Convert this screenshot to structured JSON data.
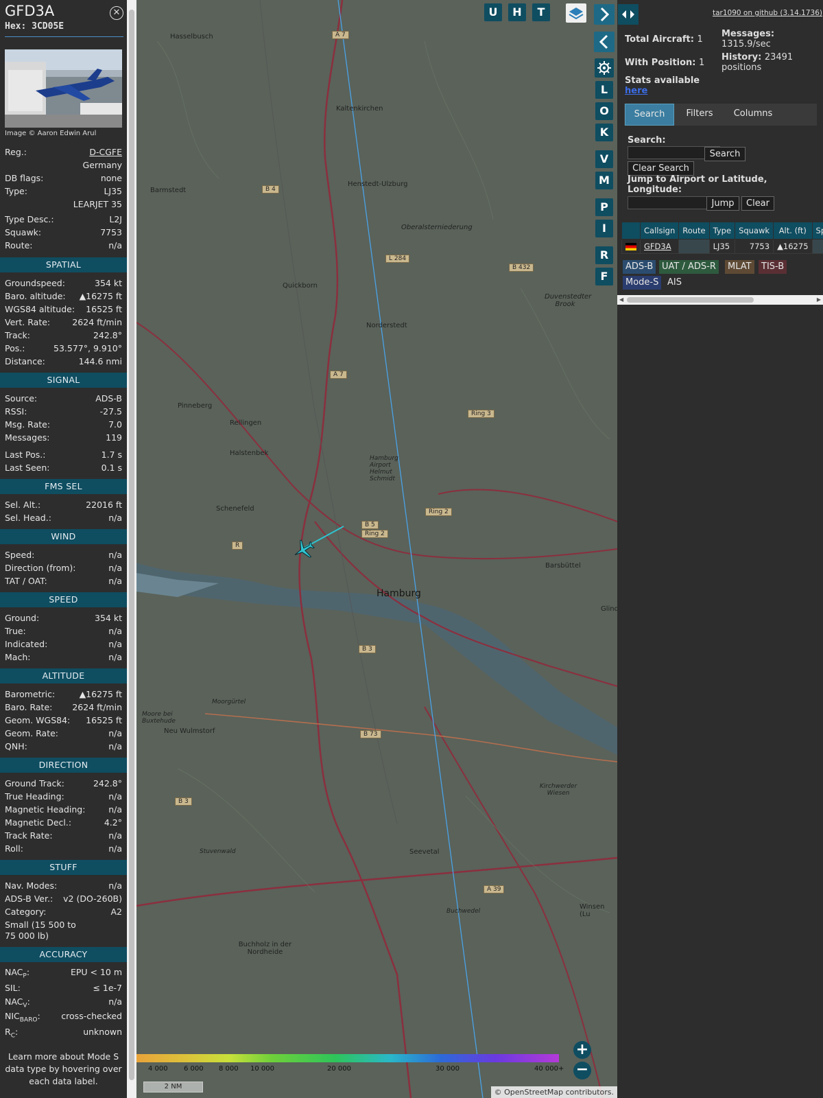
{
  "aircraft": {
    "callsign": "GFD3A",
    "hex_label": "Hex:",
    "hex": "3CD05E",
    "image_credit": "Image © Aaron Edwin Arul",
    "basic": [
      {
        "k": "Reg.:",
        "v": "D-CGFE"
      },
      {
        "k": "",
        "v": "Germany"
      },
      {
        "k": "DB flags:",
        "v": "none"
      },
      {
        "k": "Type:",
        "v": "LJ35"
      },
      {
        "k": "",
        "v": "LEARJET 35"
      },
      {
        "k": "Type Desc.:",
        "v": "L2J"
      },
      {
        "k": "Squawk:",
        "v": "7753"
      },
      {
        "k": "Route:",
        "v": "n/a"
      }
    ]
  },
  "sections": {
    "spatial": {
      "title": "SPATIAL",
      "rows": [
        {
          "k": "Groundspeed:",
          "v": "354 kt"
        },
        {
          "k": "Baro. altitude:",
          "v": "▲16275 ft"
        },
        {
          "k": "WGS84 altitude:",
          "v": "16525 ft"
        },
        {
          "k": "Vert. Rate:",
          "v": "2624 ft/min"
        },
        {
          "k": "Track:",
          "v": "242.8°"
        },
        {
          "k": "Pos.:",
          "v": "53.577°, 9.910°"
        },
        {
          "k": "Distance:",
          "v": "144.6 nmi"
        }
      ]
    },
    "signal": {
      "title": "SIGNAL",
      "rows": [
        {
          "k": "Source:",
          "v": "ADS-B"
        },
        {
          "k": "RSSI:",
          "v": "-27.5"
        },
        {
          "k": "Msg. Rate:",
          "v": "7.0"
        },
        {
          "k": "Messages:",
          "v": "119"
        },
        {
          "k": "Last Pos.:",
          "v": "1.7 s"
        },
        {
          "k": "Last Seen:",
          "v": "0.1 s"
        }
      ]
    },
    "fms": {
      "title": "FMS SEL",
      "rows": [
        {
          "k": "Sel. Alt.:",
          "v": "22016 ft"
        },
        {
          "k": "Sel. Head.:",
          "v": "n/a"
        }
      ]
    },
    "wind": {
      "title": "WIND",
      "rows": [
        {
          "k": "Speed:",
          "v": "n/a"
        },
        {
          "k": "Direction (from):",
          "v": "n/a"
        },
        {
          "k": "TAT / OAT:",
          "v": "n/a"
        }
      ]
    },
    "speed": {
      "title": "SPEED",
      "rows": [
        {
          "k": "Ground:",
          "v": "354 kt"
        },
        {
          "k": "True:",
          "v": "n/a"
        },
        {
          "k": "Indicated:",
          "v": "n/a"
        },
        {
          "k": "Mach:",
          "v": "n/a"
        }
      ]
    },
    "altitude": {
      "title": "ALTITUDE",
      "rows": [
        {
          "k": "Barometric:",
          "v": "▲16275 ft"
        },
        {
          "k": "Baro. Rate:",
          "v": "2624 ft/min"
        },
        {
          "k": "Geom. WGS84:",
          "v": "16525 ft"
        },
        {
          "k": "Geom. Rate:",
          "v": "n/a"
        },
        {
          "k": "QNH:",
          "v": "n/a"
        }
      ]
    },
    "direction": {
      "title": "DIRECTION",
      "rows": [
        {
          "k": "Ground Track:",
          "v": "242.8°"
        },
        {
          "k": "True Heading:",
          "v": "n/a"
        },
        {
          "k": "Magnetic Heading:",
          "v": "n/a"
        },
        {
          "k": "Magnetic Decl.:",
          "v": "4.2°"
        },
        {
          "k": "Track Rate:",
          "v": "n/a"
        },
        {
          "k": "Roll:",
          "v": "n/a"
        }
      ]
    },
    "stuff": {
      "title": "STUFF",
      "rows": [
        {
          "k": "Nav. Modes:",
          "v": "n/a"
        },
        {
          "k": "ADS-B Ver.:",
          "v": "v2 (DO-260B)"
        },
        {
          "k": "Category:",
          "v": "A2"
        }
      ],
      "category_desc_1": "Small (15 500 to",
      "category_desc_2": "75 000 lb)"
    },
    "accuracy": {
      "title": "ACCURACY",
      "nacp_k": "NAC",
      "nacp_sub": "P",
      "nacp_v": "EPU < 10 m",
      "sil_k": "SIL:",
      "sil_v": "≤ 1e-7",
      "nacv_k": "NAC",
      "nacv_sub": "V",
      "nacv_v": "n/a",
      "nic_k": "NIC",
      "nic_sub": "BARO",
      "nic_v": "cross-checked",
      "rc_k": "R",
      "rc_sub": "C",
      "rc_v": "unknown"
    }
  },
  "footnote": [
    "Learn more about Mode S",
    "data type by hovering over",
    "each data label."
  ],
  "map": {
    "top_buttons": [
      "U",
      "H",
      "T"
    ],
    "side_buttons": [
      "L",
      "O",
      "K",
      "V",
      "M",
      "P",
      "I",
      "R",
      "F"
    ],
    "cities": [
      "Hasselbusch",
      "Kaltenkirchen",
      "Barmstedt",
      "Henstedt-Ulzburg",
      "Oberalsterniederung",
      "Quickborn",
      "Norderstedt",
      "Duvenstedter Brook",
      "Pinneberg",
      "Rellingen",
      "Halstenbek",
      "Hamburg Airport Helmut Schmidt",
      "Schenefeld",
      "Hamburg",
      "Barsbüttel",
      "Neu Wulmstorf",
      "Moorgürtel",
      "Moore bei Buxtehude",
      "Kirchwerder Wiesen",
      "Seevetal",
      "Stuvenwald",
      "Buchwedel",
      "Buchholz in der Nordheide",
      "Winsen (Lu",
      "Glinde"
    ],
    "road_labels": [
      "A 7",
      "B 4",
      "L 284",
      "B 432",
      "A 7",
      "Ring 3",
      "B 5",
      "Ring 2",
      "Ring 2",
      "R",
      "B 3",
      "B 73",
      "B 3",
      "A 39"
    ],
    "altitude_ticks": [
      "4 000",
      "6 000",
      "8 000",
      "10 000",
      "20 000",
      "30 000",
      "40 000+"
    ],
    "scale": "2 NM",
    "attribution": "© OpenStreetMap contributors."
  },
  "panel": {
    "github_link": "tar1090 on github (3.14.1736)",
    "total_aircraft_label": "Total Aircraft:",
    "total_aircraft": "1",
    "with_position_label": "With Position:",
    "with_position": "1",
    "messages_label": "Messages:",
    "messages_rate": "1315.9/sec",
    "history_label": "History:",
    "history_value": "23491",
    "history_unit": "positions",
    "stats_label": "Stats available",
    "stats_link": "here",
    "tabs": [
      "Search",
      "Filters",
      "Columns"
    ],
    "search_label": "Search:",
    "search_button": "Search",
    "clear_search_button": "Clear Search",
    "jump_label_1": "Jump to Airport or Latitude,",
    "jump_label_2": "Longitude:",
    "jump_button": "Jump",
    "clear_button": "Clear",
    "table": {
      "headers": [
        "",
        "Callsign",
        "Route",
        "Type",
        "Squawk",
        "Alt. (ft)",
        "Spd"
      ],
      "row": {
        "callsign": "GFD3A",
        "route": "",
        "type": "LJ35",
        "squawk": "7753",
        "alt": "▲16275"
      }
    },
    "source_tags": [
      "ADS-B",
      "UAT / ADS-R",
      "MLAT",
      "TIS-B",
      "Mode-S",
      "AIS"
    ]
  },
  "colors": {
    "accent": "#0f4d61",
    "track": "#2fc4d0",
    "route_line": "#4aa3e8"
  }
}
